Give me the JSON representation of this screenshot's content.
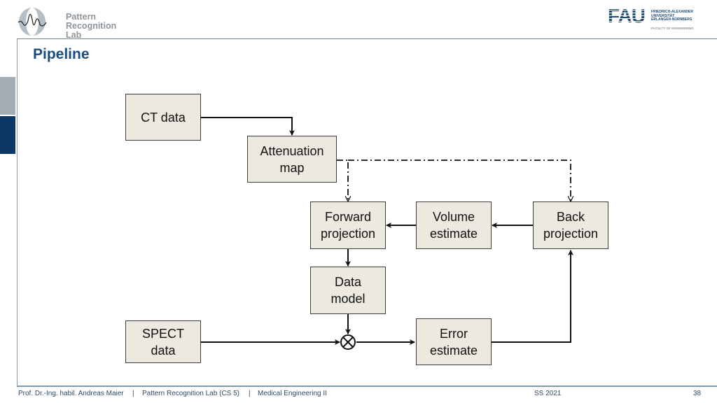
{
  "header": {
    "logo_text": [
      "Pattern",
      "Recognition",
      "Lab"
    ],
    "fau_abbrev": "FAU",
    "fau_name": [
      "FRIEDRICH-ALEXANDER",
      "UNIVERSITÄT",
      "ERLANGEN-NÜRNBERG"
    ],
    "fau_faculty": "FACULTY OF ENGINEERING",
    "title": "Pipeline"
  },
  "diagram": {
    "nodes": {
      "ct_data": {
        "lines": [
          "CT data"
        ]
      },
      "attenuation_map": {
        "lines": [
          "Attenuation",
          "map"
        ]
      },
      "forward_projection": {
        "lines": [
          "Forward",
          "projection"
        ]
      },
      "volume_estimate": {
        "lines": [
          "Volume",
          "estimate"
        ]
      },
      "back_projection": {
        "lines": [
          "Back",
          "projection"
        ]
      },
      "data_model": {
        "lines": [
          "Data",
          "model"
        ]
      },
      "spect_data": {
        "lines": [
          "SPECT",
          "data"
        ]
      },
      "error_estimate": {
        "lines": [
          "Error",
          "estimate"
        ]
      }
    },
    "combiner_symbol": "⊗",
    "edges": [
      {
        "from": "ct_data",
        "to": "attenuation_map",
        "style": "solid"
      },
      {
        "from": "attenuation_map",
        "to": "forward_projection",
        "style": "dash-dot"
      },
      {
        "from": "attenuation_map",
        "to": "back_projection",
        "style": "dash-dot"
      },
      {
        "from": "back_projection",
        "to": "volume_estimate",
        "style": "solid"
      },
      {
        "from": "volume_estimate",
        "to": "forward_projection",
        "style": "solid"
      },
      {
        "from": "forward_projection",
        "to": "data_model",
        "style": "solid"
      },
      {
        "from": "data_model",
        "to": "combiner",
        "style": "solid"
      },
      {
        "from": "spect_data",
        "to": "combiner",
        "style": "solid"
      },
      {
        "from": "combiner",
        "to": "error_estimate",
        "style": "solid"
      },
      {
        "from": "error_estimate",
        "to": "back_projection",
        "style": "solid"
      }
    ]
  },
  "footer": {
    "author": "Prof. Dr.-Ing. habil. Andreas Maier",
    "sep": "|",
    "lab": "Pattern Recognition Lab (CS 5)",
    "course": "Medical Engineering II",
    "semester": "SS 2021",
    "page": "38"
  }
}
